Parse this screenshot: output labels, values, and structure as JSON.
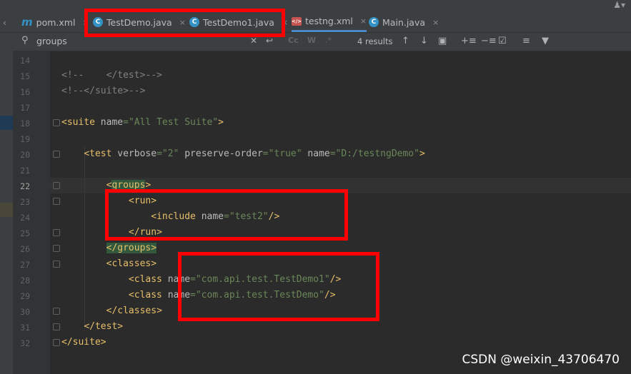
{
  "tabs": [
    {
      "label": "pom.xml",
      "icon": "maven-icon",
      "close": "×"
    },
    {
      "label": "TestDemo.java",
      "icon": "java-class-icon",
      "close": "×"
    },
    {
      "label": "TestDemo1.java",
      "icon": "java-class-icon",
      "close": "×"
    },
    {
      "label": "testng.xml",
      "icon": "xml-file-icon",
      "close": "×",
      "active": true
    },
    {
      "label": "Main.java",
      "icon": "java-class-icon",
      "close": "×"
    }
  ],
  "find_bar": {
    "query": "groups",
    "results": "4 results",
    "toggles": {
      "match_case": "Cc",
      "words": "W",
      "regex": ".*"
    }
  },
  "editor": {
    "current_line": 22,
    "lines": [
      {
        "n": "14",
        "text": ""
      },
      {
        "n": "15",
        "text": "<!--    </test>-->"
      },
      {
        "n": "16",
        "text": "<!--</suite>-->"
      },
      {
        "n": "17",
        "text": ""
      },
      {
        "n": "18",
        "text": "<suite name=\"All Test Suite\">"
      },
      {
        "n": "19",
        "text": ""
      },
      {
        "n": "20",
        "text": "    <test verbose=\"2\" preserve-order=\"true\" name=\"D:/testngDemo\">"
      },
      {
        "n": "21",
        "text": ""
      },
      {
        "n": "22",
        "text": "        <groups>"
      },
      {
        "n": "23",
        "text": "            <run>"
      },
      {
        "n": "24",
        "text": "                <include name=\"test2\"/>"
      },
      {
        "n": "25",
        "text": "            </run>"
      },
      {
        "n": "26",
        "text": "        </groups>"
      },
      {
        "n": "27",
        "text": "        <classes>"
      },
      {
        "n": "28",
        "text": "            <class name=\"com.api.test.TestDemo1\"/>"
      },
      {
        "n": "29",
        "text": "            <class name=\"com.api.test.TestDemo\"/>"
      },
      {
        "n": "30",
        "text": "        </classes>"
      },
      {
        "n": "31",
        "text": "    </test>"
      },
      {
        "n": "32",
        "text": "</suite>"
      }
    ]
  },
  "watermark": "CSDN @weixin_43706470",
  "colors": {
    "accent": "#4a88c7",
    "annotation": "#ff0000",
    "tag": "#e8bf6a",
    "string": "#6a8759"
  }
}
